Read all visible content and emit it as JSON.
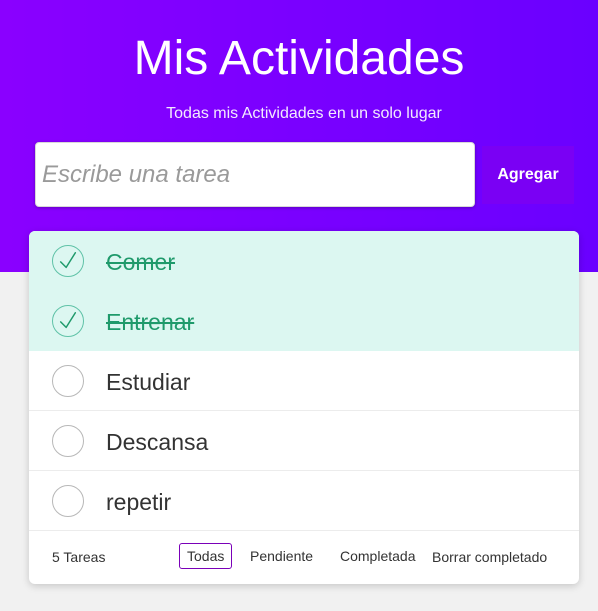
{
  "header": {
    "title": "Mis Actividades",
    "subtitle": "Todas mis Actividades en un solo lugar"
  },
  "new_task": {
    "placeholder": "Escribe una tarea",
    "value": "",
    "add_label": "Agregar"
  },
  "tasks": [
    {
      "label": "Comer",
      "completed": true
    },
    {
      "label": "Entrenar",
      "completed": true
    },
    {
      "label": "Estudiar",
      "completed": false
    },
    {
      "label": "Descansa",
      "completed": false
    },
    {
      "label": "repetir",
      "completed": false
    }
  ],
  "footer": {
    "count_label": "5 Tareas",
    "filters": [
      {
        "label": "Todas",
        "active": true
      },
      {
        "label": "Pendiente",
        "active": false
      },
      {
        "label": "Completada",
        "active": false
      }
    ],
    "clear_label": "Borrar completado"
  },
  "colors": {
    "header_gradient_start": "#8a00ff",
    "header_gradient_end": "#6a00ff",
    "add_button": "#7a00f4",
    "completed_row_bg": "#dcf7f1",
    "completed_text": "#1f9a6b",
    "active_filter_border": "#7a00b8"
  },
  "icons": {
    "check": "checkmark-icon",
    "pending": "empty-circle"
  }
}
